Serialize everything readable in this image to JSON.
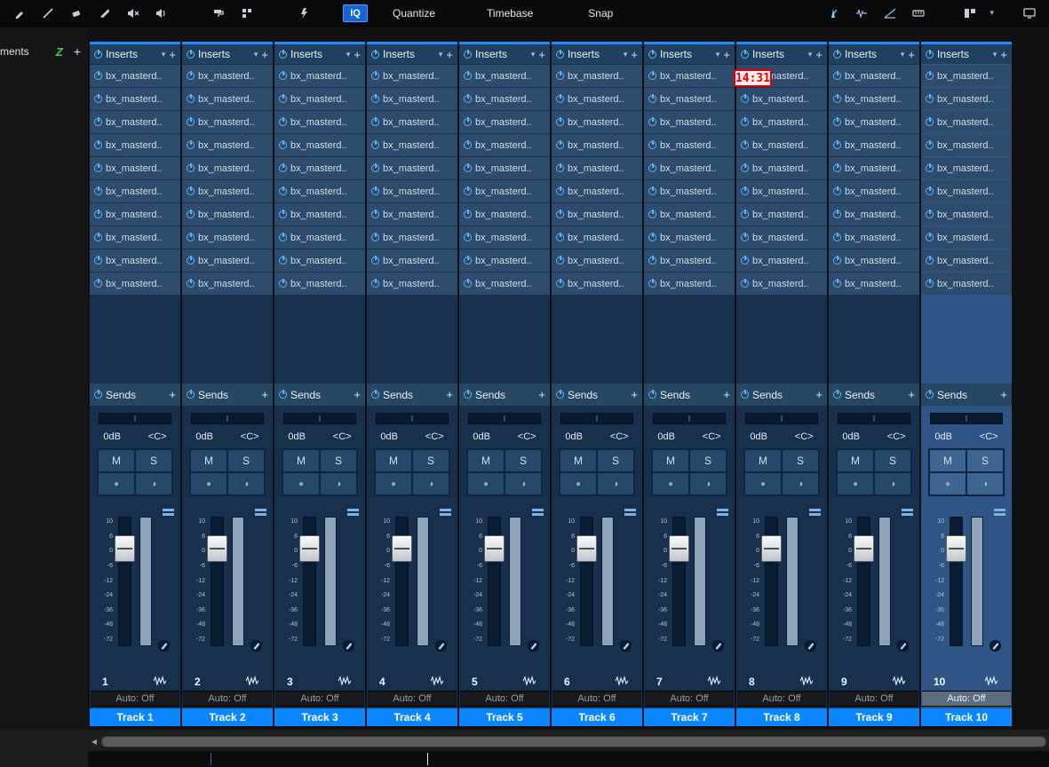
{
  "toolbar": {
    "iq_button": "IQ",
    "quantize_label": "Quantize",
    "timebase_label": "Timebase",
    "snap_label": "Snap"
  },
  "left_panel": {
    "label": "ments",
    "zoom_label": "Z",
    "add_label": "+"
  },
  "recording_timer": "14:31",
  "icons": {
    "chevron_down": "▾",
    "plus": "+",
    "record": "●",
    "monitor": "◑",
    "scroll_left": "◀"
  },
  "colors": {
    "accent_blue": "#1f8fff",
    "track_label_blue": "#0a86ff",
    "channel_bg": "#16304e",
    "selected_channel_bg": "#2e5585",
    "timer_red": "#e00000"
  },
  "mixer": {
    "inserts_label": "Inserts",
    "sends_label": "Sends",
    "gain_label": "0dB",
    "pan_label": "<C>",
    "mute_label": "M",
    "solo_label": "S",
    "auto_label": "Auto: Off",
    "scale": [
      "10",
      "6",
      "0",
      "-6",
      "-12",
      "-24",
      "-36",
      "-48",
      "-72"
    ],
    "selected_index": 9,
    "channels": [
      {
        "number": "1",
        "name": "Track 1",
        "inserts": [
          "bx_masterd..",
          "bx_masterd..",
          "bx_masterd..",
          "bx_masterd..",
          "bx_masterd..",
          "bx_masterd..",
          "bx_masterd..",
          "bx_masterd..",
          "bx_masterd..",
          "bx_masterd.."
        ]
      },
      {
        "number": "2",
        "name": "Track 2",
        "inserts": [
          "bx_masterd..",
          "bx_masterd..",
          "bx_masterd..",
          "bx_masterd..",
          "bx_masterd..",
          "bx_masterd..",
          "bx_masterd..",
          "bx_masterd..",
          "bx_masterd..",
          "bx_masterd.."
        ]
      },
      {
        "number": "3",
        "name": "Track 3",
        "inserts": [
          "bx_masterd..",
          "bx_masterd..",
          "bx_masterd..",
          "bx_masterd..",
          "bx_masterd..",
          "bx_masterd..",
          "bx_masterd..",
          "bx_masterd..",
          "bx_masterd..",
          "bx_masterd.."
        ]
      },
      {
        "number": "4",
        "name": "Track 4",
        "inserts": [
          "bx_masterd..",
          "bx_masterd..",
          "bx_masterd..",
          "bx_masterd..",
          "bx_masterd..",
          "bx_masterd..",
          "bx_masterd..",
          "bx_masterd..",
          "bx_masterd..",
          "bx_masterd.."
        ]
      },
      {
        "number": "5",
        "name": "Track 5",
        "inserts": [
          "bx_masterd..",
          "bx_masterd..",
          "bx_masterd..",
          "bx_masterd..",
          "bx_masterd..",
          "bx_masterd..",
          "bx_masterd..",
          "bx_masterd..",
          "bx_masterd..",
          "bx_masterd.."
        ]
      },
      {
        "number": "6",
        "name": "Track 6",
        "inserts": [
          "bx_masterd..",
          "bx_masterd..",
          "bx_masterd..",
          "bx_masterd..",
          "bx_masterd..",
          "bx_masterd..",
          "bx_masterd..",
          "bx_masterd..",
          "bx_masterd..",
          "bx_masterd.."
        ]
      },
      {
        "number": "7",
        "name": "Track 7",
        "inserts": [
          "bx_masterd..",
          "bx_masterd..",
          "bx_masterd..",
          "bx_masterd..",
          "bx_masterd..",
          "bx_masterd..",
          "bx_masterd..",
          "bx_masterd..",
          "bx_masterd..",
          "bx_masterd.."
        ]
      },
      {
        "number": "8",
        "name": "Track 8",
        "inserts": [
          "bx_masterd..",
          "bx_masterd..",
          "bx_masterd..",
          "bx_masterd..",
          "bx_masterd..",
          "bx_masterd..",
          "bx_masterd..",
          "bx_masterd..",
          "bx_masterd..",
          "bx_masterd.."
        ]
      },
      {
        "number": "9",
        "name": "Track 9",
        "inserts": [
          "bx_masterd..",
          "bx_masterd..",
          "bx_masterd..",
          "bx_masterd..",
          "bx_masterd..",
          "bx_masterd..",
          "bx_masterd..",
          "bx_masterd..",
          "bx_masterd..",
          "bx_masterd.."
        ]
      },
      {
        "number": "10",
        "name": "Track 10",
        "inserts": [
          "bx_masterd..",
          "bx_masterd..",
          "bx_masterd..",
          "bx_masterd..",
          "bx_masterd..",
          "bx_masterd..",
          "bx_masterd..",
          "bx_masterd..",
          "bx_masterd..",
          "bx_masterd.."
        ]
      }
    ]
  }
}
